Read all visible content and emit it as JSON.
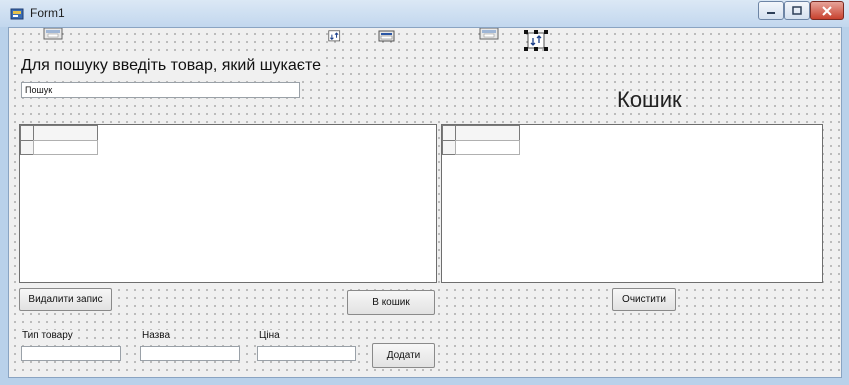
{
  "window": {
    "title": "Form1"
  },
  "search": {
    "label": "Для пошуку введіть товар, який шукаєте",
    "value": "Пошук"
  },
  "cart": {
    "title": "Кошик"
  },
  "buttons": {
    "delete": "Видалити запис",
    "to_cart": "В кошик",
    "clear": "Очистити",
    "add": "Додати"
  },
  "fields": {
    "type_label": "Тип товару",
    "name_label": "Назва",
    "price_label": "Ціна",
    "type_value": "",
    "name_value": "",
    "price_value": ""
  },
  "icons": {
    "caption_min": "minimize-icon",
    "caption_max": "maximize-icon",
    "caption_close": "close-icon"
  }
}
